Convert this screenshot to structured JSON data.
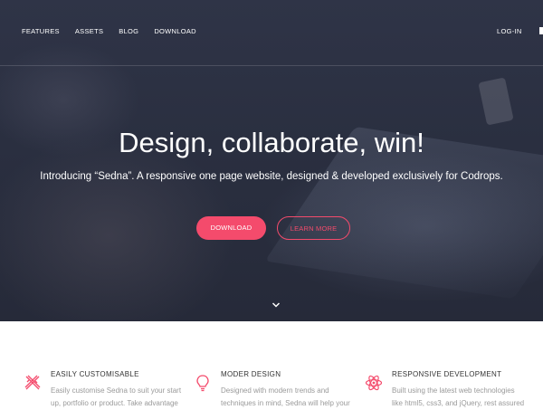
{
  "nav": {
    "links": [
      "FEATURES",
      "ASSETS",
      "BLOG",
      "DOWNLOAD"
    ],
    "login": "LOG-IN"
  },
  "hero": {
    "title": "Design, collaborate, win!",
    "subtitle": "Introducing “Sedna”. A responsive one page website, designed & developed exclusively for Codrops.",
    "primary_button": "DOWNLOAD",
    "secondary_button": "LEARN MORE",
    "scroll_icon": "chevron-down-icon"
  },
  "features": [
    {
      "icon": "pencil-ruler-icon",
      "title": "EASILY CUSTOMISABLE",
      "lines": [
        "Easily customise Sedna to suit your start",
        "up, portfolio or product. Take advantage"
      ]
    },
    {
      "icon": "lightbulb-icon",
      "title": "MODER DESIGN",
      "lines": [
        "Designed with modern trends and",
        "techniques in mind, Sedna will help your"
      ]
    },
    {
      "icon": "atom-icon",
      "title": "RESPONSIVE DEVELOPMENT",
      "lines": [
        "Built using the latest web technologies",
        "like html5, css3, and jQuery, rest assured"
      ]
    }
  ],
  "colors": {
    "accent": "#f44b6c",
    "hero_background": "#2a2f40",
    "feature_title": "#333333",
    "feature_text": "#9a9a9a"
  }
}
